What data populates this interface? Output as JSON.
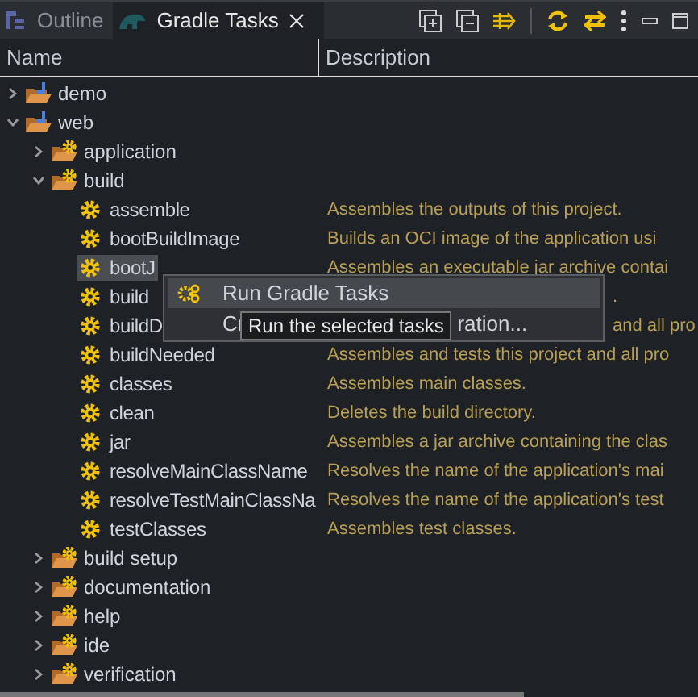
{
  "tabs": [
    {
      "label": "Outline",
      "kind": "outline",
      "selected": false,
      "closable": false
    },
    {
      "label": "Gradle Tasks",
      "kind": "gradle",
      "selected": true,
      "closable": true
    }
  ],
  "columns": [
    "Name",
    "Description"
  ],
  "tree": [
    {
      "name": "demo",
      "kind": "project",
      "expanded": false
    },
    {
      "name": "web",
      "kind": "project",
      "expanded": true,
      "children": [
        {
          "name": "application",
          "kind": "group",
          "expanded": false
        },
        {
          "name": "build",
          "kind": "group",
          "expanded": true,
          "children": [
            {
              "name": "assemble",
              "kind": "task",
              "selected": false,
              "description": "Assembles the outputs of this project."
            },
            {
              "name": "bootBuildImage",
              "kind": "task",
              "selected": false,
              "description": "Builds an OCI image of the application usi"
            },
            {
              "name": "bootJ",
              "kind": "task",
              "selected": true,
              "description": "Assembles an executable jar archive contai"
            },
            {
              "name": "build",
              "kind": "task",
              "selected": false,
              "covered": true,
              "description": "."
            },
            {
              "name": "buildD",
              "kind": "task",
              "selected": false,
              "covered": true,
              "description": "and all pro"
            },
            {
              "name": "buildNeeded",
              "kind": "task",
              "selected": false,
              "description": "Assembles and tests this project and all pro"
            },
            {
              "name": "classes",
              "kind": "task",
              "selected": false,
              "description": "Assembles main classes."
            },
            {
              "name": "clean",
              "kind": "task",
              "selected": false,
              "description": "Deletes the build directory."
            },
            {
              "name": "jar",
              "kind": "task",
              "selected": false,
              "description": "Assembles a jar archive containing the clas"
            },
            {
              "name": "resolveMainClassName",
              "kind": "task",
              "selected": false,
              "description": "Resolves the name of the application's mai"
            },
            {
              "name": "resolveTestMainClassNa",
              "kind": "task",
              "selected": false,
              "description": "Resolves the name of the application's test"
            },
            {
              "name": "testClasses",
              "kind": "task",
              "selected": false,
              "description": "Assembles test classes."
            }
          ]
        },
        {
          "name": "build setup",
          "kind": "group",
          "expanded": false
        },
        {
          "name": "documentation",
          "kind": "group",
          "expanded": false
        },
        {
          "name": "help",
          "kind": "group",
          "expanded": false
        },
        {
          "name": "ide",
          "kind": "group",
          "expanded": false
        },
        {
          "name": "verification",
          "kind": "group",
          "expanded": false
        }
      ]
    }
  ],
  "context_menu": {
    "items": [
      {
        "label": "Run Gradle Tasks",
        "selected": true
      },
      {
        "label_start": "Cr",
        "label_end": "ration...",
        "selected": false
      }
    ]
  },
  "tooltip": "Run the selected tasks"
}
